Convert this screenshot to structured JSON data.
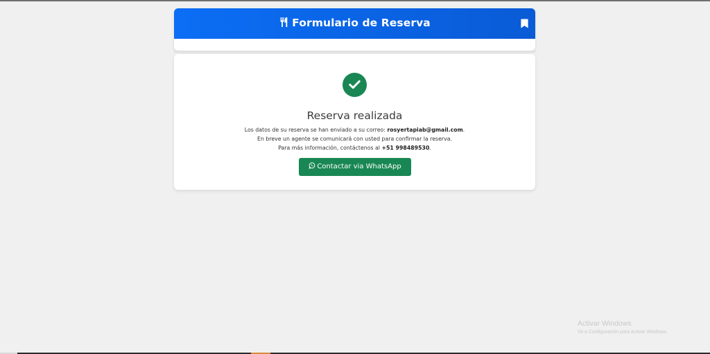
{
  "header": {
    "title": "Formulario de Reserva",
    "icon": "utensils-icon",
    "action_icon": "bookmark-icon"
  },
  "confirmation": {
    "status_icon": "check-circle-icon",
    "title": "Reserva realizada",
    "line1_prefix": "Los datos de su reserva se han enviado a su correo: ",
    "email": "rosyertapiab@gmail.com",
    "line1_suffix": ".",
    "line2": "En breve un agente se comunicará con usted para confirmar la reserva.",
    "line3_prefix": "Para más información, contáctenos al ",
    "phone": "+51 998489530",
    "line3_suffix": ".",
    "whatsapp_button": {
      "label": "Contactar via WhatsApp",
      "icon": "whatsapp-icon"
    }
  },
  "watermark": {
    "title": "Activar Windows",
    "subtitle": "Ve a Configuración para activar Windows."
  },
  "colors": {
    "primary": "#0b6ef5",
    "success": "#198754",
    "background": "#f0f0f0"
  }
}
